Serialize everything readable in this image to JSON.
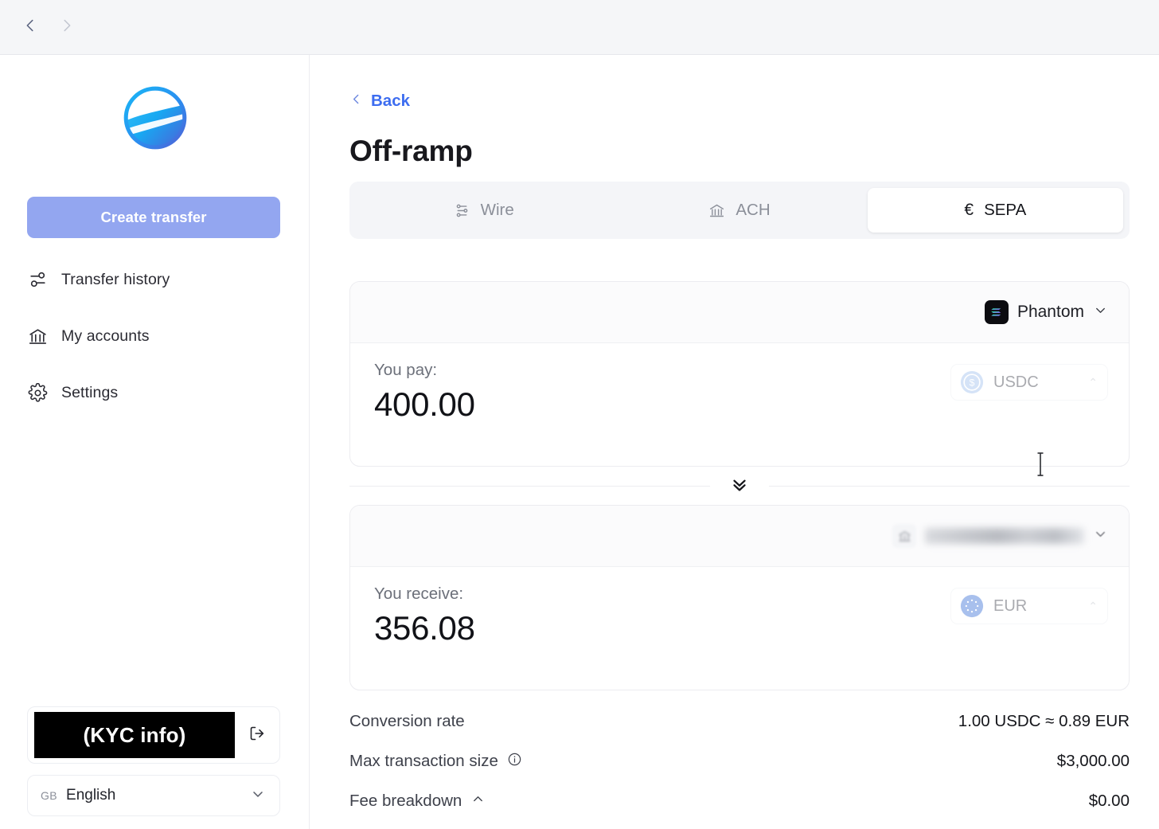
{
  "browser": {
    "back_icon": "chevron-left-icon",
    "forward_icon": "chevron-right-icon"
  },
  "sidebar": {
    "logo_name": "app-logo",
    "create_transfer_label": "Create transfer",
    "items": [
      {
        "label": "Transfer history",
        "icon": "transfer-history-icon"
      },
      {
        "label": "My accounts",
        "icon": "bank-icon"
      },
      {
        "label": "Settings",
        "icon": "gear-icon"
      }
    ],
    "kyc_label": "(KYC info)",
    "logout_icon": "logout-icon",
    "language": {
      "country_code": "GB",
      "label": "English",
      "caret": "chevron-down-icon"
    }
  },
  "main": {
    "back_label": "Back",
    "page_title": "Off-ramp",
    "tabs": [
      {
        "label": "Wire",
        "icon": "wire-transfer-icon",
        "active": false
      },
      {
        "label": "ACH",
        "icon": "bank-icon",
        "active": false
      },
      {
        "label": "SEPA",
        "icon": "euro-icon",
        "symbol": "€",
        "active": true
      }
    ],
    "pay_card": {
      "wallet_name": "Phantom",
      "wallet_icon": "phantom-wallet-icon",
      "wallet_caret": "chevron-down-icon",
      "caption": "You pay:",
      "amount": "400.00",
      "currency": "USDC",
      "currency_icon": "usdc-coin-icon"
    },
    "swap_icon": "double-chevron-down-icon",
    "receive_card": {
      "account_name": "",
      "account_icon": "bank-icon",
      "account_caret": "chevron-down-icon",
      "caption": "You receive:",
      "amount": "356.08",
      "currency": "EUR",
      "currency_icon": "euro-coin-icon"
    },
    "details": [
      {
        "label": "Conversion rate",
        "value": "1.00 USDC ≈ 0.89 EUR",
        "info": false,
        "caret": ""
      },
      {
        "label": "Max transaction size",
        "value": "$3,000.00",
        "info": true,
        "caret": ""
      },
      {
        "label": "Fee breakdown",
        "value": "$0.00",
        "info": false,
        "caret": "chevron-up-icon"
      }
    ]
  },
  "colors": {
    "accent": "#3d6df0",
    "primary_button": "#93a6f0",
    "tab_bar_bg": "#f4f5f8",
    "text_primary": "#15161b",
    "text_muted": "#6c707a"
  }
}
